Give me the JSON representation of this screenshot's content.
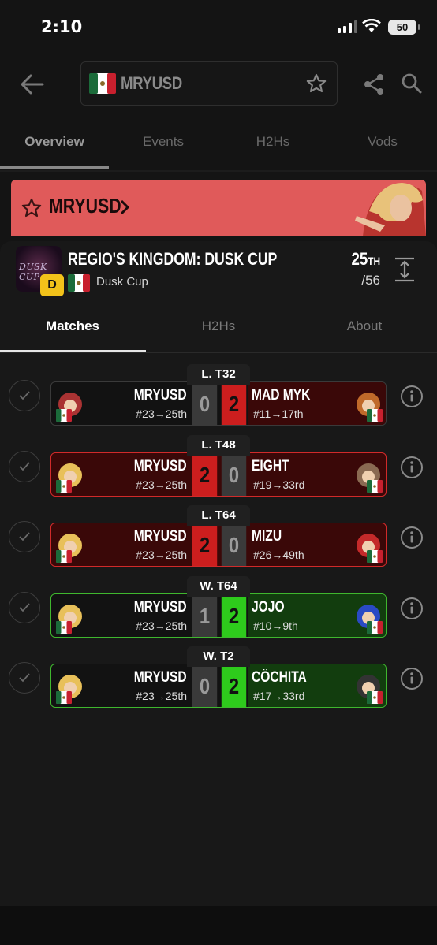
{
  "status_bar": {
    "time": "2:10",
    "battery": "50"
  },
  "header": {
    "search_value": "MRYUSD"
  },
  "top_tabs": [
    "Overview",
    "Events",
    "H2Hs",
    "Vods"
  ],
  "banner": {
    "player": "MRYUSD"
  },
  "event": {
    "logo_text": "DUSK CUP",
    "tier": "D",
    "title": "REGIO'S KINGDOM: DUSK CUP",
    "subtitle": "Dusk Cup",
    "placement": "25",
    "placement_suffix": "TH",
    "entrants": "/56"
  },
  "inner_tabs": [
    "Matches",
    "H2Hs",
    "About"
  ],
  "matches": [
    {
      "round": "L. T32",
      "p1": "MRYUSD",
      "p1_seed": "#23→25th",
      "p1_score": "0",
      "p2_score": "2",
      "p2": "MAD MYK",
      "p2_seed": "#11→17th"
    },
    {
      "round": "L. T48",
      "p1": "MRYUSD",
      "p1_seed": "#23→25th",
      "p1_score": "2",
      "p2_score": "0",
      "p2": "EIGHT",
      "p2_seed": "#19→33rd"
    },
    {
      "round": "L. T64",
      "p1": "MRYUSD",
      "p1_seed": "#23→25th",
      "p1_score": "2",
      "p2_score": "0",
      "p2": "MIZU",
      "p2_seed": "#26→49th"
    },
    {
      "round": "W. T64",
      "p1": "MRYUSD",
      "p1_seed": "#23→25th",
      "p1_score": "1",
      "p2_score": "2",
      "p2": "JOJO",
      "p2_seed": "#10→9th"
    },
    {
      "round": "W. T2",
      "p1": "MRYUSD",
      "p1_seed": "#23→25th",
      "p1_score": "0",
      "p2_score": "2",
      "p2": "CÖCHITA",
      "p2_seed": "#17→33rd"
    }
  ],
  "colors": {
    "banner": "#e05a5a",
    "win_red": "#cc1e1e",
    "loss_green": "#2ecb1c",
    "tier_badge": "#f2c21a"
  }
}
